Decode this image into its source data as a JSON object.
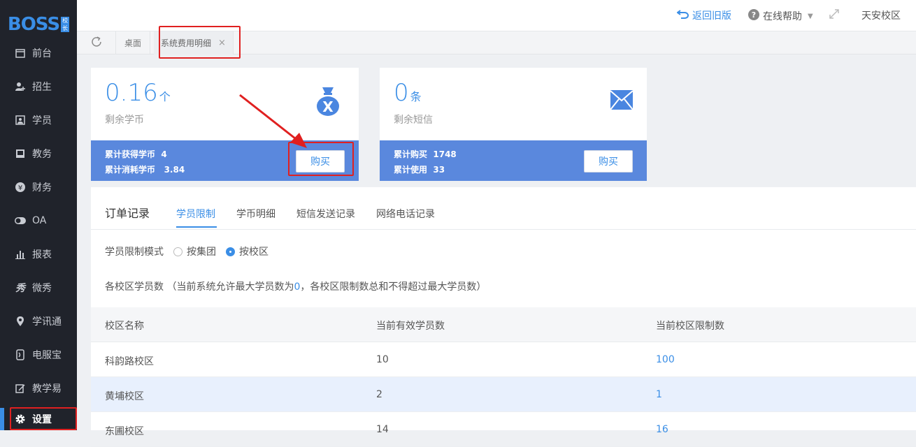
{
  "logo": {
    "text": "BOSS",
    "badge": "校长"
  },
  "sidebar": {
    "items": [
      {
        "label": "前台",
        "icon": "calendar-icon"
      },
      {
        "label": "招生",
        "icon": "user-add-icon"
      },
      {
        "label": "学员",
        "icon": "student-card-icon"
      },
      {
        "label": "教务",
        "icon": "book-icon"
      },
      {
        "label": "财务",
        "icon": "yen-icon"
      },
      {
        "label": "OA",
        "icon": "toggle-icon"
      },
      {
        "label": "报表",
        "icon": "bar-chart-icon"
      },
      {
        "label": "微秀",
        "icon": "xiu-icon"
      },
      {
        "label": "学讯通",
        "icon": "location-icon"
      },
      {
        "label": "电服宝",
        "icon": "phone-icon"
      },
      {
        "label": "教学易",
        "icon": "edit-icon"
      },
      {
        "label": "设置",
        "icon": "gear-icon"
      }
    ]
  },
  "topbar": {
    "back_old": "返回旧版",
    "help": "在线帮助",
    "campus": "天安校区"
  },
  "tabs": {
    "desk": "桌面",
    "current": "系统费用明细",
    "close": "×"
  },
  "coin_card": {
    "value": "0.16",
    "unit": "个",
    "label": "剩余学币",
    "earned_label": "累计获得学币",
    "earned_value": "4",
    "consumed_label": "累计消耗学币",
    "consumed_value": "3.84",
    "buy": "购买"
  },
  "sms_card": {
    "value": "0",
    "unit": "条",
    "label": "剩余短信",
    "bought_label": "累计购买",
    "bought_value": "1748",
    "used_label": "累计使用",
    "used_value": "33",
    "buy": "购买"
  },
  "orders": {
    "title": "订单记录",
    "tabs": [
      "学员限制",
      "学币明细",
      "短信发送记录",
      "网络电话记录"
    ],
    "mode_label": "学员限制模式",
    "mode_options": [
      "按集团",
      "按校区"
    ],
    "desc_prefix": "各校区学员数 （当前系统允许最大学员数为",
    "desc_value": "0",
    "desc_suffix": "，各校区限制数总和不得超过最大学员数）",
    "columns": [
      "校区名称",
      "当前有效学员数",
      "当前校区限制数"
    ],
    "rows": [
      {
        "name": "科韵路校区",
        "active": "10",
        "limit": "100"
      },
      {
        "name": "黄埔校区",
        "active": "2",
        "limit": "1"
      },
      {
        "name": "东圃校区",
        "active": "14",
        "limit": "16"
      }
    ]
  },
  "colors": {
    "accent": "#3a8ee6",
    "sidebar": "#20232b",
    "highlight": "#e02020"
  }
}
